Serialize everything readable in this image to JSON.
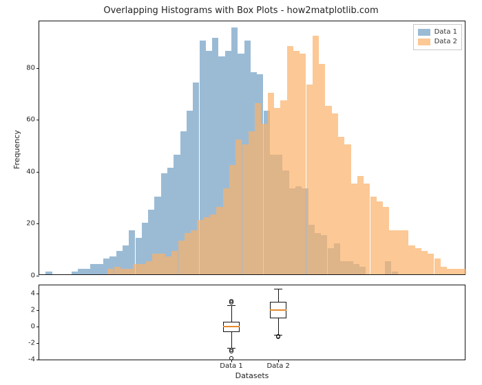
{
  "title": "Overlapping Histograms with Box Plots - how2matplotlib.com",
  "legend": {
    "items": [
      "Data 1",
      "Data 2"
    ]
  },
  "ylabel_top": "Frequency",
  "xlabel_bottom": "Datasets",
  "yticks_top": [
    0,
    20,
    40,
    60,
    80
  ],
  "yticks_bottom": [
    -4,
    -2,
    0,
    2,
    4
  ],
  "xticks_bottom": [
    "Data 1",
    "Data 2"
  ],
  "colors": {
    "data1": "#719EC3",
    "data2": "#FBB168"
  },
  "chart_data": [
    {
      "type": "bar",
      "name": "histogram",
      "title": "Overlapping Histograms with Box Plots - how2matplotlib.com",
      "xlabel": "",
      "ylabel": "Frequency",
      "ylim": [
        0,
        98
      ],
      "xlim": [
        -4,
        6
      ],
      "bins_count": 50,
      "legend_position": "upper right",
      "series": [
        {
          "name": "Data 1",
          "color": "#719EC3",
          "alpha": 0.7,
          "x_start": -4.0,
          "bin_width": 0.15,
          "values": [
            0,
            1,
            0,
            0,
            0,
            1,
            2,
            2,
            4,
            4,
            6,
            7,
            9,
            11,
            17,
            14,
            20,
            25,
            30,
            39,
            41,
            46,
            55,
            63,
            74,
            90,
            86,
            91,
            84,
            86,
            95,
            85,
            90,
            78,
            77,
            63,
            46,
            46,
            40,
            33,
            34,
            33,
            19,
            16,
            15,
            10,
            12,
            5,
            5,
            4,
            3,
            0,
            0,
            0,
            5,
            1,
            0,
            0,
            0,
            0,
            0,
            0,
            0,
            0,
            0,
            0,
            0
          ]
        },
        {
          "name": "Data 2",
          "color": "#FBB168",
          "alpha": 0.7,
          "x_start": -2.7,
          "bin_width": 0.15,
          "values": [
            0,
            0,
            2,
            3,
            2,
            2,
            4,
            4,
            5,
            8,
            8,
            7,
            9,
            13,
            16,
            17,
            21,
            22,
            23,
            26,
            33,
            42,
            52,
            50,
            55,
            66,
            58,
            70,
            64,
            67,
            88,
            86,
            85,
            73,
            92,
            81,
            65,
            62,
            53,
            50,
            35,
            38,
            35,
            30,
            28,
            26,
            17,
            17,
            17,
            11,
            10,
            9,
            8,
            6,
            3,
            2,
            2,
            2
          ]
        }
      ]
    },
    {
      "type": "box",
      "name": "boxplots",
      "xlabel": "Datasets",
      "ylabel": "",
      "ylim": [
        -4.2,
        5.0
      ],
      "categories": [
        "Data 1",
        "Data 2"
      ],
      "series": [
        {
          "name": "Data 1",
          "q1": -0.7,
          "median": 0.0,
          "q3": 0.6,
          "whisker_low": -2.6,
          "whisker_high": 2.6,
          "fliers": [
            -3.9,
            -3.0,
            -2.85,
            2.9,
            3.05,
            3.1
          ]
        },
        {
          "name": "Data 2",
          "q1": 1.0,
          "median": 2.0,
          "q3": 3.0,
          "whisker_low": -1.0,
          "whisker_high": 4.6,
          "fliers": [
            -1.3,
            -1.2
          ]
        }
      ]
    }
  ]
}
